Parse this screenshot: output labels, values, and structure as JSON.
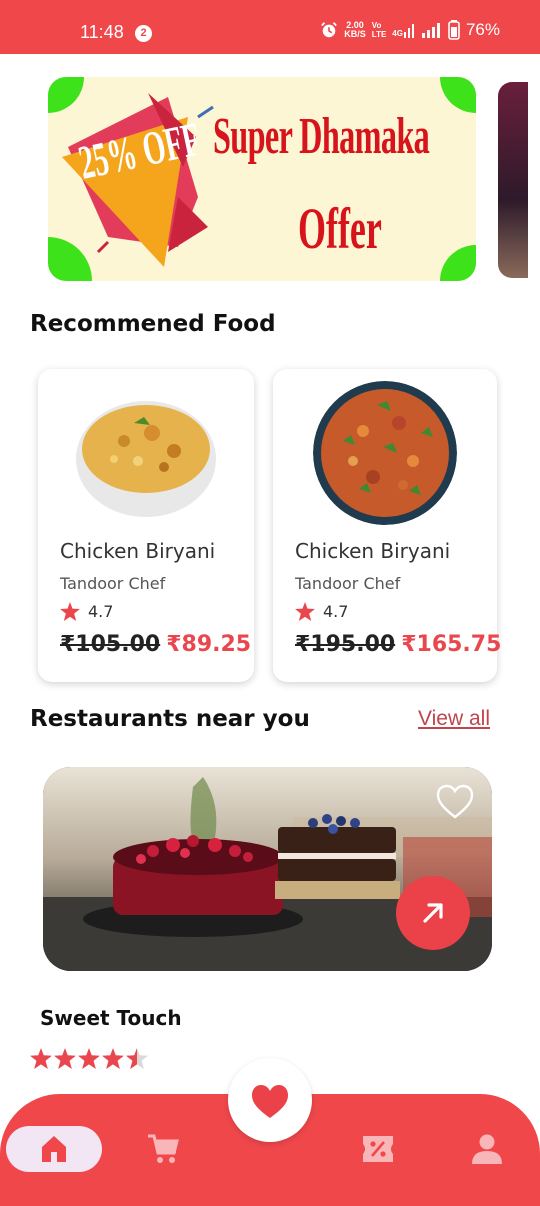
{
  "status_bar": {
    "time": "11:48",
    "notification_count": "2",
    "net_speed_value": "2.00",
    "net_speed_unit": "KB/S",
    "volte_top": "Vo",
    "volte_bottom": "LTE",
    "network": "4G",
    "battery": "76%"
  },
  "banner": {
    "headline": "Super Dhamaka",
    "subline": "Offer",
    "discount": "25% OFF"
  },
  "recommended": {
    "title": "Recommened Food",
    "items": [
      {
        "name": "Chicken Biryani",
        "vendor": "Tandoor Chef",
        "rating": "4.7",
        "old_price": "₹105.00",
        "new_price": "₹89.25",
        "image": "biryani-plate-image"
      },
      {
        "name": "Chicken Biryani",
        "vendor": "Tandoor Chef",
        "rating": "4.7",
        "old_price": "₹195.00",
        "new_price": "₹165.75",
        "image": "fried-rice-plate-image"
      }
    ]
  },
  "restaurants": {
    "title": "Restaurants near you",
    "view_all": "View all",
    "items": [
      {
        "name": "Sweet Touch",
        "rating": 4.5,
        "image": "cake-restaurant-image"
      }
    ]
  },
  "bottom_nav": {
    "items": [
      "home-icon",
      "cart-icon",
      "favorites-icon",
      "offers-icon",
      "profile-icon"
    ],
    "active": "home-icon"
  },
  "colors": {
    "accent": "#f0474b",
    "price_new": "#e9474d",
    "home_pill": "#f3e6f4"
  }
}
